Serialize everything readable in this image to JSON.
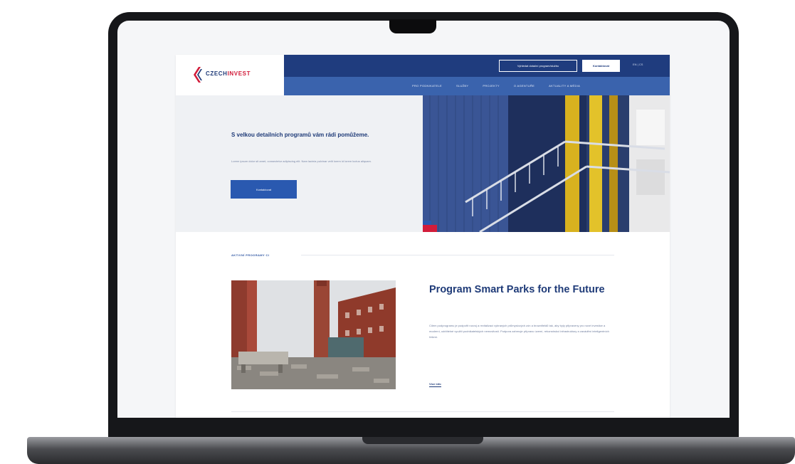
{
  "site": {
    "logo": {
      "part1": "CZECH",
      "part2": "INVEST"
    },
    "header": {
      "cta_outline": "Vyhledat dotační program/službu",
      "cta_primary": "Kontaktovat",
      "lang": "EN  |  CS",
      "nav": [
        "PRO PODNIKATELE",
        "SLUŽBY",
        "PROJEKTY",
        "O AGENTUŘE",
        "AKTUALITY A MÉDIA"
      ]
    },
    "hero": {
      "title": "S velkou detailních programů vám rádi pomůžeme.",
      "text": "Lorem ipsum dolor sit amet, consectetur adipiscing elit. Nam lacinia pulvinar velit lorem id lorem luctus aliquam.",
      "button": "Kontaktovat"
    },
    "section": {
      "label": "AKTIVNÍ PROGRAMY CI",
      "card": {
        "title": "Program Smart Parks for the Future",
        "text": "Cílem podprogramu je podpořit rozvoj a revitalizaci vybraných průmyslových zón a brownfieldů tak, aby byly připraveny pro nové investice a moderní, udržitelné využití podnikatelských nemovitostí. Podpora zahrnuje přípravu území, rekonstrukci infrastruktury a zavádění inteligentních řešení.",
        "link": "Více info"
      }
    }
  },
  "colors": {
    "navy": "#1f3c7e",
    "blue": "#3a63ad",
    "accent_red": "#d21c3a"
  }
}
